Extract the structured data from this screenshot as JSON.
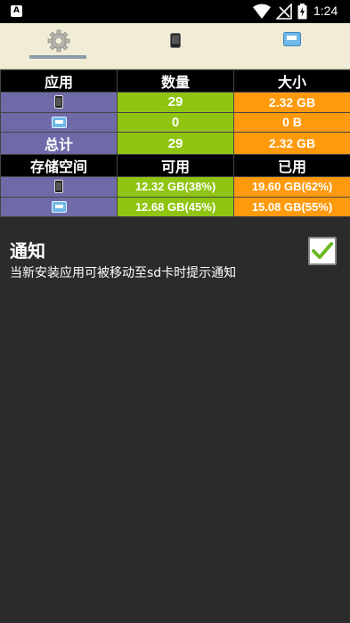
{
  "status_bar": {
    "time": "1:24"
  },
  "tabs": [
    {
      "icon": "gear-icon",
      "active": true
    },
    {
      "icon": "phone-icon",
      "active": false
    },
    {
      "icon": "sd-card-icon",
      "active": false
    }
  ],
  "apps_table": {
    "headers": [
      "应用",
      "数量",
      "大小"
    ],
    "rows": [
      {
        "icon": "phone-icon",
        "count": "29",
        "size": "2.32 GB"
      },
      {
        "icon": "sd-card-icon",
        "count": "0",
        "size": "0 B"
      }
    ],
    "total": {
      "label": "总计",
      "count": "29",
      "size": "2.32 GB"
    }
  },
  "storage_table": {
    "headers": [
      "存储空间",
      "可用",
      "已用"
    ],
    "rows": [
      {
        "icon": "phone-icon",
        "available": "12.32 GB(38%)",
        "used": "19.60 GB(62%)"
      },
      {
        "icon": "sd-card-icon",
        "available": "12.68 GB(45%)",
        "used": "15.08 GB(55%)"
      }
    ]
  },
  "notification": {
    "title": "通知",
    "description": "当新安装应用可被移动至sd卡时提示通知",
    "checked": true
  },
  "colors": {
    "purple": "#6e6aa8",
    "green": "#8fc511",
    "orange": "#ff9a0d",
    "check": "#6ab820"
  }
}
